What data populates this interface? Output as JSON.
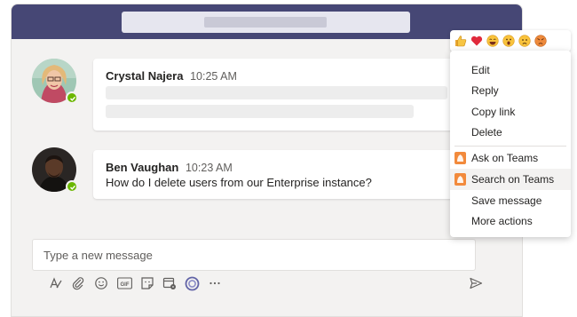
{
  "messages": [
    {
      "author": "Crystal Najera",
      "time": "10:25 AM"
    },
    {
      "author": "Ben Vaughan",
      "time": "10:23 AM",
      "text": "How do I delete users from our Enterprise instance?"
    }
  ],
  "compose": {
    "placeholder": "Type a new message"
  },
  "toolbar": {
    "icons": [
      "format-icon",
      "attach-icon",
      "emoji-icon",
      "gif-icon",
      "sticker-icon",
      "meet-icon",
      "loop-icon",
      "more-icon",
      "send-icon"
    ],
    "gif_label": "GIF"
  },
  "reactions": [
    "like",
    "heart",
    "laugh",
    "surprised",
    "sad",
    "angry"
  ],
  "menu": {
    "items": [
      "Edit",
      "Reply",
      "Copy link",
      "Delete"
    ],
    "apps": [
      "Ask on Teams",
      "Search on Teams"
    ],
    "extra": [
      "Save message",
      "More actions"
    ]
  },
  "colors": {
    "titlebar": "#464775",
    "presence": "#6bb700",
    "app_icon": "#f28a3c",
    "loop": "#6264a7"
  }
}
